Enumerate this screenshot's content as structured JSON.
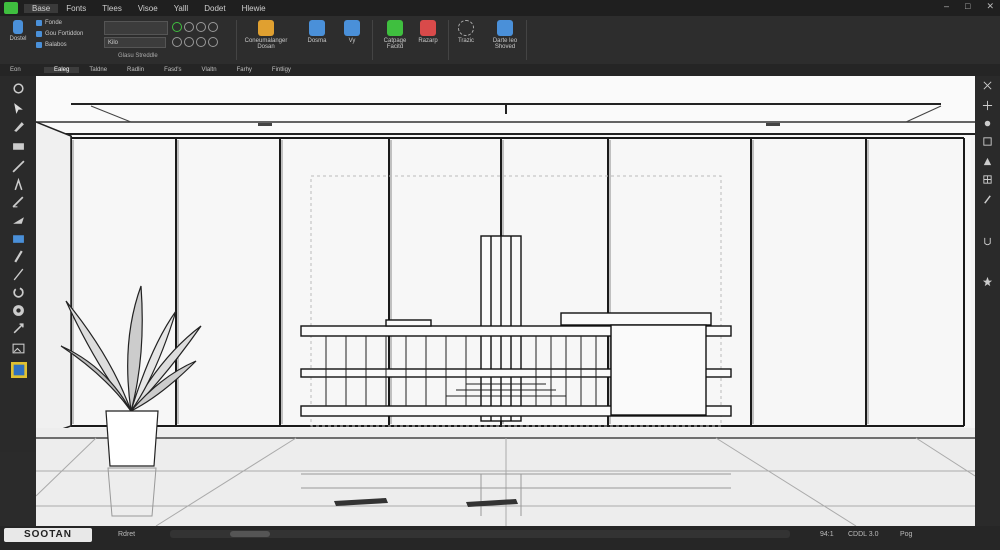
{
  "menubar": {
    "items": [
      "Base",
      "Fonts",
      "Tlees",
      "Visoe",
      "Yalll",
      "Dodet",
      "Hlewie"
    ],
    "window_controls": [
      "–",
      "□",
      "✕"
    ]
  },
  "ribbon": {
    "big_button_1": "Dostel",
    "small_rows": [
      "Fonde",
      "Gou Fortiddon",
      "Balabos"
    ],
    "field_value": "Kilo",
    "group_label": "Glasu Streddle",
    "buttons": [
      {
        "label": "Coneumalanger",
        "sub": "Dosan"
      },
      {
        "label": "Dosma",
        "sub": ""
      },
      {
        "label": "Vy",
        "sub": ""
      },
      {
        "label": "Catpage",
        "sub": "Facitd"
      },
      {
        "label": "Razarp",
        "sub": ""
      },
      {
        "label": "Trazic",
        "sub": ""
      },
      {
        "label": "Darte leo",
        "sub": "Shoved"
      }
    ]
  },
  "tabs": [
    "Ealeg",
    "Taldne",
    "Radlin",
    "Fasd's",
    "Vlaltn",
    "Farhy",
    "Fintligy"
  ],
  "sidebar_label": "Eon",
  "status": {
    "logo": "SOOTAN",
    "left_text": "Rdret",
    "coords": "94:1",
    "zoom": "CDDL 3.0",
    "extra": "Pog"
  },
  "colors": {
    "accent": "#3fbf3f",
    "blue": "#4a90d9",
    "dark": "#2b2b2b"
  }
}
